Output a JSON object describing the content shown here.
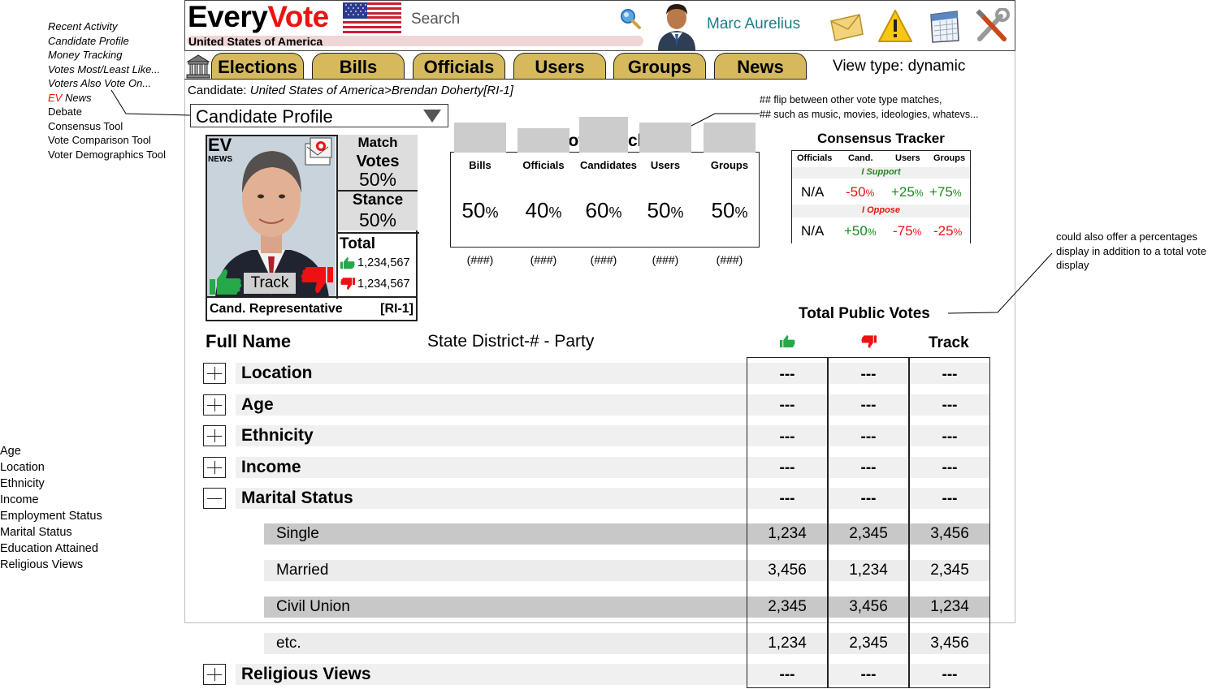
{
  "left_nav": {
    "items": [
      "Recent Activity",
      "Candidate Profile",
      "Money Tracking",
      "Votes Most/Least Like...",
      "Voters Also Vote On..."
    ],
    "ev_news_prefix": "EV",
    "ev_news_suffix": " News",
    "plain_items": [
      "Debate",
      "Consensus Tool",
      "Vote Comparison Tool",
      "Voter Demographics Tool"
    ]
  },
  "demographics_list": [
    "Age",
    "Location",
    "Ethnicity",
    "Income",
    "Employment Status",
    "Marital Status",
    "Education Attained",
    "Religious Views"
  ],
  "header": {
    "logo_every": "Every",
    "logo_vote": "Vote",
    "country": "United States of America",
    "search_placeholder": "Search",
    "user_name": "Marc Aurelius"
  },
  "tabs": [
    "Elections",
    "Bills",
    "Officials",
    "Users",
    "Groups",
    "News"
  ],
  "view_type": "View type: dynamic",
  "breadcrumb": {
    "prefix": "Candidate: ",
    "path": "United States of America>Brendan Doherty[RI-1]"
  },
  "view_select": "Candidate Profile",
  "note_flip": [
    "## flip between other vote type matches,",
    "## such as music, movies, ideologies, whatevs..."
  ],
  "note_percent": "could also offer a percentages display in addition to a total vote display",
  "candidate": {
    "ev_badge": "EV",
    "news_badge": "NEWS",
    "match_label": "Match",
    "votes_label": "Votes",
    "votes_pct": "50%",
    "stance_label": "Stance",
    "stance_pct": "50%",
    "total_label": "Total",
    "total_up": "1,234,567",
    "total_down": "1,234,567",
    "track_label": "Track",
    "role": "Cand. Representative",
    "district": "[RI-1]"
  },
  "vote_match": {
    "title": "Vote Match",
    "columns": [
      {
        "label": "Bills",
        "value": 50,
        "pct_num": "50",
        "count": "(###)"
      },
      {
        "label": "Officials",
        "value": 40,
        "pct_num": "40",
        "count": "(###)"
      },
      {
        "label": "Candidates",
        "value": 60,
        "pct_num": "60",
        "count": "(###)"
      },
      {
        "label": "Users",
        "value": 50,
        "pct_num": "50",
        "count": "(###)"
      },
      {
        "label": "Groups",
        "value": 50,
        "pct_num": "50",
        "count": "(###)"
      }
    ],
    "pct_sign": "%"
  },
  "consensus": {
    "title": "Consensus Tracker",
    "headers": [
      "Officials",
      "Cand.",
      "Users",
      "Groups"
    ],
    "support_label": "I Support",
    "oppose_label": "I Oppose",
    "support_row": {
      "officials": "N/A",
      "cand": "-50",
      "users": "+25",
      "groups": "+75"
    },
    "oppose_row": {
      "officials": "N/A",
      "cand": "+50",
      "users": "-75",
      "groups": "-25"
    },
    "pct_sign": "%"
  },
  "public_votes": {
    "title": "Total Public Votes",
    "col_name": "Full Name",
    "col_district": "State District-# - Party",
    "col_track": "Track",
    "rows": [
      {
        "label": "Location",
        "up": "---",
        "down": "---",
        "track": "---",
        "expanded": false
      },
      {
        "label": "Age",
        "up": "---",
        "down": "---",
        "track": "---",
        "expanded": false
      },
      {
        "label": "Ethnicity",
        "up": "---",
        "down": "---",
        "track": "---",
        "expanded": false
      },
      {
        "label": "Income",
        "up": "---",
        "down": "---",
        "track": "---",
        "expanded": false
      },
      {
        "label": "Marital Status",
        "up": "---",
        "down": "---",
        "track": "---",
        "expanded": true
      }
    ],
    "sub_rows": [
      {
        "label": "Single",
        "up": "1,234",
        "down": "2,345",
        "track": "3,456"
      },
      {
        "label": "Married",
        "up": "3,456",
        "down": "1,234",
        "track": "2,345"
      },
      {
        "label": "Civil Union",
        "up": "2,345",
        "down": "3,456",
        "track": "1,234"
      },
      {
        "label": "etc.",
        "up": "1,234",
        "down": "2,345",
        "track": "3,456"
      }
    ],
    "last_row": {
      "label": "Religious Views",
      "up": "---",
      "down": "---",
      "track": "---"
    }
  },
  "colors": {
    "brand_red": "#e11111",
    "tab_gold": "#d5b95c",
    "up_green": "#27a84a",
    "down_red": "#e11111",
    "username_teal": "#1b7f86"
  }
}
